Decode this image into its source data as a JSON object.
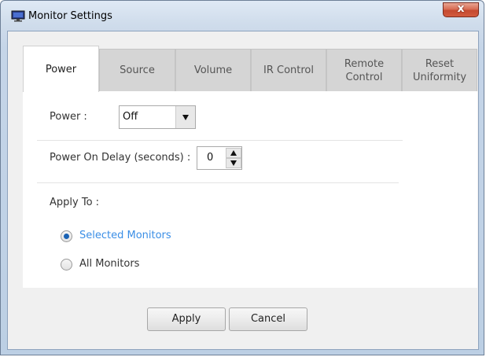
{
  "window": {
    "title": "Monitor Settings",
    "close_label": "x"
  },
  "tabs": [
    {
      "label": "Power",
      "active": true
    },
    {
      "label": "Source",
      "active": false
    },
    {
      "label": "Volume",
      "active": false
    },
    {
      "label": "IR Control",
      "active": false
    },
    {
      "label": "Remote Control",
      "active": false
    },
    {
      "label": "Reset Uniformity",
      "active": false
    }
  ],
  "power": {
    "label": "Power :",
    "selected": "Off"
  },
  "power_on_delay": {
    "label": "Power On Delay (seconds) :",
    "value": "0"
  },
  "apply_to": {
    "label": "Apply To :",
    "options": [
      {
        "label": "Selected Monitors",
        "checked": true
      },
      {
        "label": "All Monitors",
        "checked": false
      }
    ]
  },
  "buttons": {
    "apply": "Apply",
    "cancel": "Cancel"
  },
  "colors": {
    "selected_radio_text": "#3a8ee6",
    "radio_dot": "#1a62b4",
    "close_button": "#c54a30"
  }
}
